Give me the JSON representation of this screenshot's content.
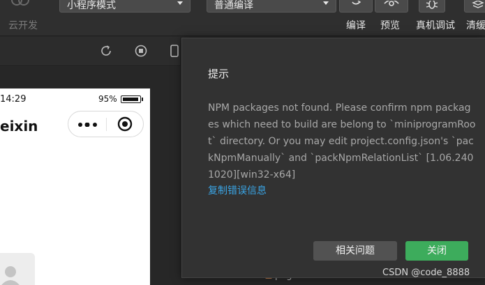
{
  "toolbar": {
    "cloud_label": "云开发",
    "mode_select": "小程序模式",
    "compile_select": "普通编译",
    "labels": {
      "compile": "编译",
      "preview": "预览",
      "remote_debug": "真机调试",
      "clear_cache": "清缓"
    },
    "icons": [
      "cloud-icon",
      "refresh-icon",
      "eye-icon",
      "bug-icon",
      "layers-icon"
    ]
  },
  "simulator": {
    "status_time": "14:29",
    "battery_percent": "95%",
    "nav_title": "eixin"
  },
  "file_tree": {
    "visible_item": "pages"
  },
  "dialog": {
    "title": "提示",
    "message": "NPM packages not found. Please confirm npm packages which need to build are belong to `miniprogramRoot` directory. Or you may edit project.config.json's `packNpmManually` and `packNpmRelationList` [1.06.2401020][win32-x64]",
    "copy_link": "复制错误信息",
    "related_button": "相关问题",
    "close_button": "关闭"
  },
  "watermark": "CSDN @code_8888",
  "colors": {
    "link": "#3aa5e6",
    "primary_button": "#3dac5c",
    "secondary_button": "#525252",
    "dialog_bg": "#323232"
  }
}
